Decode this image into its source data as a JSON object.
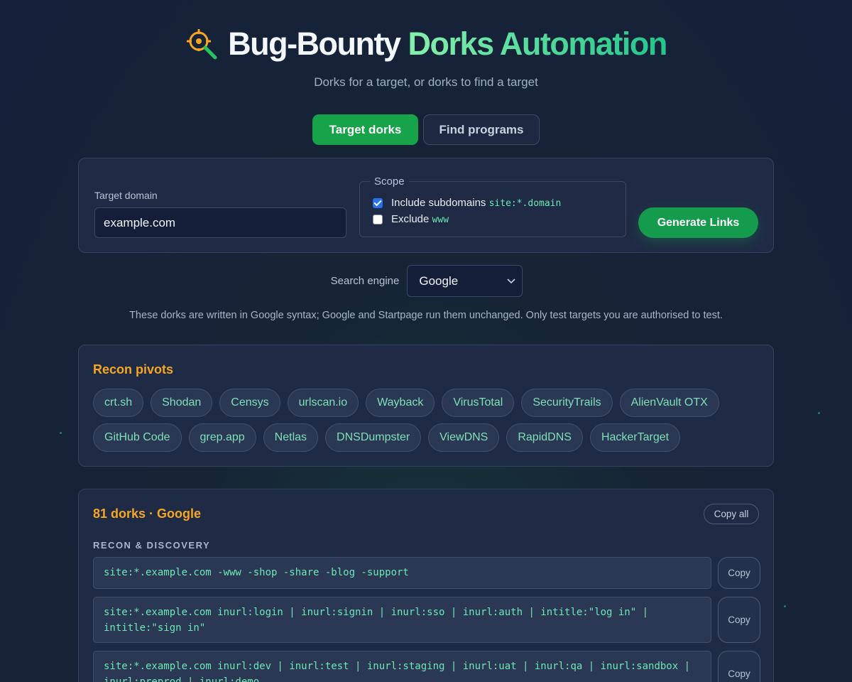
{
  "header": {
    "title_white": "Bug-Bounty",
    "title_green": "Dorks Automation",
    "subtitle": "Dorks for a target, or dorks to find a target",
    "logo_icon": "crosshair-search-icon"
  },
  "tabs": [
    {
      "label": "Target dorks",
      "active": true
    },
    {
      "label": "Find programs",
      "active": false
    }
  ],
  "form": {
    "domain_label": "Target domain",
    "domain_value": "example.com",
    "scope_legend": "Scope",
    "include_subdomains_label": "Include subdomains",
    "include_subdomains_code": "site:*.domain",
    "include_subdomains_checked": true,
    "exclude_label": "Exclude",
    "exclude_code": "www",
    "exclude_checked": false,
    "generate_label": "Generate Links"
  },
  "search_engine": {
    "label": "Search engine",
    "selected": "Google",
    "note": "These dorks are written in Google syntax; Google and Startpage run them unchanged. Only test targets you are authorised to test."
  },
  "pivots": {
    "title": "Recon pivots",
    "items": [
      "crt.sh",
      "Shodan",
      "Censys",
      "urlscan.io",
      "Wayback",
      "VirusTotal",
      "SecurityTrails",
      "AlienVault OTX",
      "GitHub Code",
      "grep.app",
      "Netlas",
      "DNSDumpster",
      "ViewDNS",
      "RapidDNS",
      "HackerTarget"
    ]
  },
  "dorks": {
    "title": "81 dorks · Google",
    "copy_all_label": "Copy all",
    "group_title": "RECON & DISCOVERY",
    "copy_label": "Copy",
    "items": [
      "site:*.example.com -www -shop -share -blog -support",
      "site:*.example.com inurl:login | inurl:signin | inurl:sso | inurl:auth | intitle:\"log in\" | intitle:\"sign in\"",
      "site:*.example.com inurl:dev | inurl:test | inurl:staging | inurl:uat | inurl:qa | inurl:sandbox | inurl:preprod | inurl:demo"
    ]
  },
  "colors": {
    "accent_green": "#16a34a",
    "section_orange": "#f5a623",
    "code_green": "#6ee7b7"
  }
}
